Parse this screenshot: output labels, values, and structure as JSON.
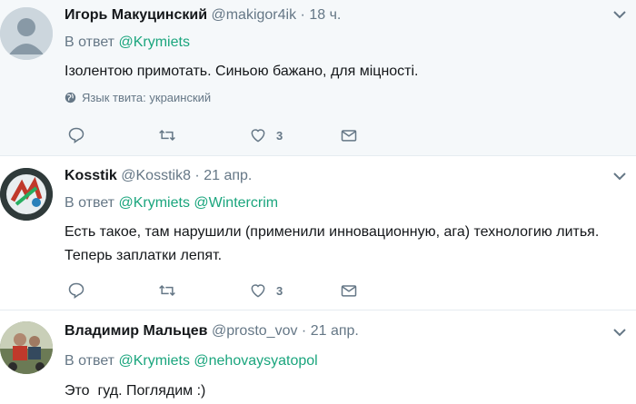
{
  "tweets": [
    {
      "fullname": "Игорь Макуцинский",
      "username": "@makigor4ik",
      "time": "18 ч.",
      "reply_prefix": "В ответ",
      "mentions": [
        "@Krymiets"
      ],
      "text": "Ізолентою примотать. Синьою бажано, для міцності.",
      "language_note": "Язык твита: украинский",
      "like_count": "3",
      "avatar": "default-avatar"
    },
    {
      "fullname": "Kosstik",
      "username": "@Kosstik8",
      "time": "21 апр.",
      "reply_prefix": "В ответ",
      "mentions": [
        "@Krymiets",
        "@Wintercrim"
      ],
      "text": "Есть такое, там нарушили (применили инновационную, ага) технологию литья. Теперь заплатки лепят.",
      "like_count": "3",
      "avatar": "logo-avatar"
    },
    {
      "fullname": "Владимир Мальцев",
      "username": "@prosto_vov",
      "time": "21 апр.",
      "reply_prefix": "В ответ",
      "mentions": [
        "@Krymiets",
        "@nehovaysyatopol"
      ],
      "text": "Это  гуд. Поглядим :)",
      "avatar": "photo-avatar"
    }
  ],
  "separator": "·",
  "icons": [
    "reply-icon",
    "retweet-icon",
    "like-icon",
    "message-icon",
    "globe-icon",
    "chevron-down-icon"
  ],
  "colors": {
    "link": "#1da1f2",
    "secondary": "#657786",
    "highlight_bg": "#f5f8fa"
  }
}
